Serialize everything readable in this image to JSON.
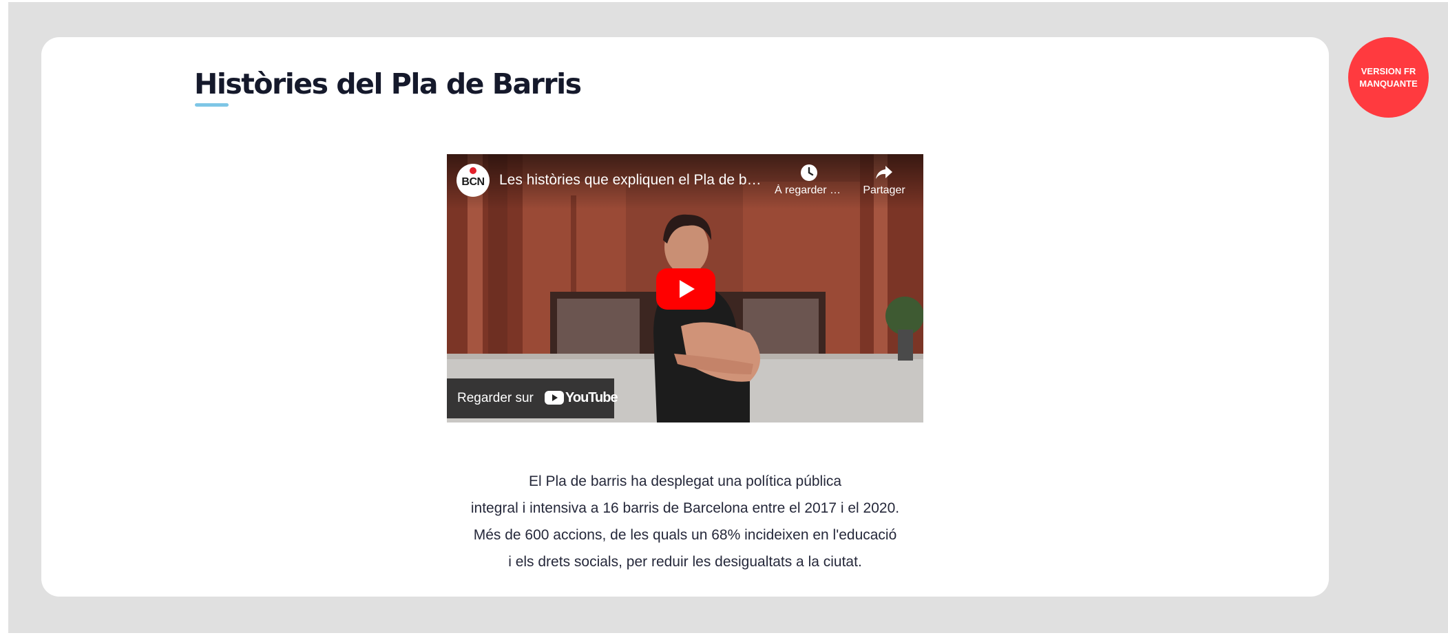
{
  "page": {
    "title": "Històries del Pla de Barris"
  },
  "badge": {
    "line1": "VERSION FR",
    "line2": "MANQUANTE"
  },
  "video": {
    "channel_initials": "BCN",
    "title": "Les històries que expliquen el Pla de barris",
    "watch_later_label": "À regarder plus tard",
    "share_label": "Partager",
    "watch_on_label": "Regarder sur",
    "platform_name": "YouTube"
  },
  "description": {
    "lines": [
      "El Pla de barris ha desplegat una política pública",
      "integral i intensiva a 16 barris de Barcelona entre el 2017 i el 2020.",
      "Més de 600 accions, de les quals un 68% incideixen en l'educació",
      "i els drets socials, per reduir les desigualtats a la ciutat."
    ]
  },
  "colors": {
    "background": "#e0e0e0",
    "card": "#ffffff",
    "title_text": "#15192b",
    "title_accent": "#7ec6e6",
    "badge": "#ff3a3f",
    "play_button": "#ff0000"
  },
  "icons": {
    "watch_later": "clock-icon",
    "share": "share-arrow-icon",
    "play": "play-icon",
    "youtube": "youtube-logo-icon"
  }
}
